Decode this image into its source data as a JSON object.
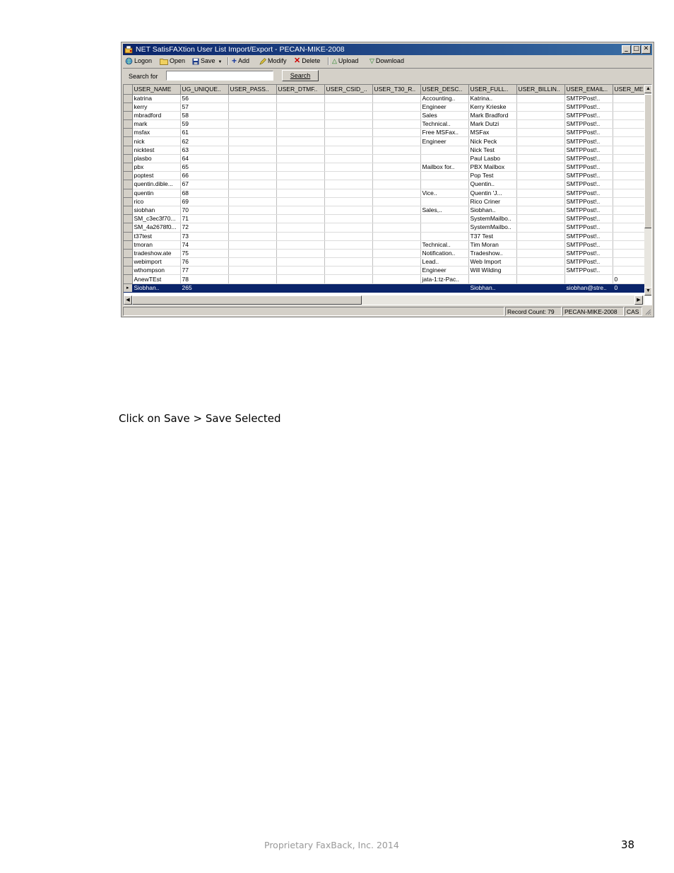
{
  "window": {
    "title": "NET SatisFAXtion User List Import/Export - PECAN-MIKE-2008",
    "minimize": "_",
    "maximize": "□",
    "close": "✕"
  },
  "toolbar": {
    "logon": "Logon",
    "open": "Open",
    "save": "Save",
    "add": "Add",
    "modify": "Modify",
    "delete": "Delete",
    "upload": "Upload",
    "download": "Download"
  },
  "search": {
    "label": "Search for",
    "value": "",
    "button": "Search"
  },
  "grid": {
    "columns": [
      "USER_NAME",
      "UG_UNIQUE..",
      "USER_PASS..",
      "USER_DTMF..",
      "USER_CSID_..",
      "USER_T30_R..",
      "USER_DESC..",
      "USER_FULL..",
      "USER_BILLIN..",
      "USER_EMAIL..",
      "USER_ME"
    ],
    "rows": [
      [
        "katrina",
        "56",
        "",
        "",
        "",
        "",
        "Accounting..",
        "Katrina..",
        "",
        "SMTPPost!..",
        ""
      ],
      [
        "kerry",
        "57",
        "",
        "",
        "",
        "",
        "Engineer",
        "Kerry Krieske",
        "",
        "SMTPPost!..",
        ""
      ],
      [
        "mbradford",
        "58",
        "",
        "",
        "",
        "",
        "Sales",
        "Mark Bradford",
        "",
        "SMTPPost!..",
        ""
      ],
      [
        "mark",
        "59",
        "",
        "",
        "",
        "",
        "Technical..",
        "Mark Dutzi",
        "",
        "SMTPPost!..",
        ""
      ],
      [
        "msfax",
        "61",
        "",
        "",
        "",
        "",
        "Free MSFax..",
        "MSFax",
        "",
        "SMTPPost!..",
        ""
      ],
      [
        "nick",
        "62",
        "",
        "",
        "",
        "",
        "Engineer",
        "Nick Peck",
        "",
        "SMTPPost!..",
        ""
      ],
      [
        "nicktest",
        "63",
        "",
        "",
        "",
        "",
        "",
        "Nick Test",
        "",
        "SMTPPost!..",
        ""
      ],
      [
        "plasbo",
        "64",
        "",
        "",
        "",
        "",
        "",
        "Paul Lasbo",
        "",
        "SMTPPost!..",
        ""
      ],
      [
        "pbx",
        "65",
        "",
        "",
        "",
        "",
        "Mailbox for..",
        "PBX Mailbox",
        "",
        "SMTPPost!..",
        ""
      ],
      [
        "poptest",
        "66",
        "",
        "",
        "",
        "",
        "",
        "Pop Test",
        "",
        "SMTPPost!..",
        ""
      ],
      [
        "quentin.dible...",
        "67",
        "",
        "",
        "",
        "",
        "",
        "Quentin..",
        "",
        "SMTPPost!..",
        ""
      ],
      [
        "quentin",
        "68",
        "",
        "",
        "",
        "",
        "Vice..",
        "Quentin 'J...",
        "",
        "SMTPPost!..",
        ""
      ],
      [
        "rico",
        "69",
        "",
        "",
        "",
        "",
        "",
        "Rico Criner",
        "",
        "SMTPPost!..",
        ""
      ],
      [
        "siobhan",
        "70",
        "",
        "",
        "",
        "",
        "Sales,..",
        "Siobhan..",
        "",
        "SMTPPost!..",
        ""
      ],
      [
        "SM_c3ec3f70...",
        "71",
        "",
        "",
        "",
        "",
        "",
        "SystemMailbo..",
        "",
        "SMTPPost!..",
        ""
      ],
      [
        "SM_4a2678f0...",
        "72",
        "",
        "",
        "",
        "",
        "",
        "SystemMailbo..",
        "",
        "SMTPPost!..",
        ""
      ],
      [
        "t37test",
        "73",
        "",
        "",
        "",
        "",
        "",
        "T37 Test",
        "",
        "SMTPPost!..",
        ""
      ],
      [
        "tmoran",
        "74",
        "",
        "",
        "",
        "",
        "Technical..",
        "Tim Moran",
        "",
        "SMTPPost!..",
        ""
      ],
      [
        "tradeshow.ate",
        "75",
        "",
        "",
        "",
        "",
        "Notification..",
        "Tradeshow..",
        "",
        "SMTPPost!..",
        ""
      ],
      [
        "webimport",
        "76",
        "",
        "",
        "",
        "",
        "Lead..",
        "Web Import",
        "",
        "SMTPPost!..",
        ""
      ],
      [
        "wthompson",
        "77",
        "",
        "",
        "",
        "",
        "Engineer",
        "Will Wilding",
        "",
        "SMTPPost!..",
        ""
      ],
      [
        "AnewTEst",
        "78",
        "",
        "",
        "",
        "",
        "jata-1:tz-Pac..",
        "",
        "",
        "",
        "0"
      ],
      [
        "Siobhan..",
        "265",
        "",
        "",
        "",
        "",
        "",
        "Siobhan..",
        "",
        "siobhan@stre..",
        "0"
      ]
    ],
    "selected_row": 22,
    "selected_indicator": "▸"
  },
  "status": {
    "record_count": "Record Count: 79",
    "server": "PECAN-MIKE-2008",
    "caps": "CAS"
  },
  "instruction": "Click on Save > Save Selected",
  "footer": "Proprietary FaxBack, Inc. 2014",
  "page_number": "38"
}
